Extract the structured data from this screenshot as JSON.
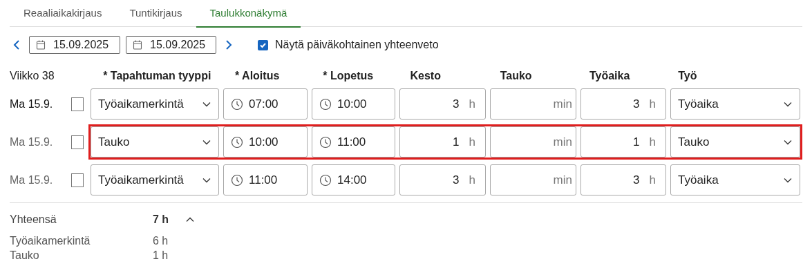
{
  "tabs": [
    {
      "label": "Reaaliaikakirjaus",
      "selected": false
    },
    {
      "label": "Tuntikirjaus",
      "selected": false
    },
    {
      "label": "Taulukkonäkymä",
      "selected": true
    }
  ],
  "toolbar": {
    "date_from": "15.09.2025",
    "date_to": "15.09.2025",
    "summary_checkbox": {
      "label": "Näytä päiväkohtainen yhteenveto",
      "checked": true
    }
  },
  "table": {
    "week": "Viikko 38",
    "columns": [
      "* Tapahtuman tyyppi",
      "* Aloitus",
      "* Lopetus",
      "Kesto",
      "Tauko",
      "Työaika",
      "Työ"
    ],
    "rows": [
      {
        "day": "Ma 15.9.",
        "dimmed": false,
        "checked": false,
        "highlighted": false,
        "type": "Työaikamerkintä",
        "start": "07:00",
        "end": "10:00",
        "duration": "3",
        "duration_unit": "h",
        "break_unit": "min",
        "work_time": "3",
        "work_time_unit": "h",
        "work": "Työaika"
      },
      {
        "day": "Ma 15.9.",
        "dimmed": true,
        "checked": false,
        "highlighted": true,
        "type": "Tauko",
        "start": "10:00",
        "end": "11:00",
        "duration": "1",
        "duration_unit": "h",
        "break_unit": "min",
        "work_time": "1",
        "work_time_unit": "h",
        "work": "Tauko"
      },
      {
        "day": "Ma 15.9.",
        "dimmed": true,
        "checked": false,
        "highlighted": false,
        "type": "Työaikamerkintä",
        "start": "11:00",
        "end": "14:00",
        "duration": "3",
        "duration_unit": "h",
        "break_unit": "min",
        "work_time": "3",
        "work_time_unit": "h",
        "work": "Työaika"
      }
    ]
  },
  "summary": {
    "label": "Yhteensä",
    "total": "7 h",
    "expanded": true,
    "items": [
      {
        "label": "Työaikamerkintä",
        "value": "6 h"
      },
      {
        "label": "Tauko",
        "value": "1 h"
      }
    ]
  }
}
